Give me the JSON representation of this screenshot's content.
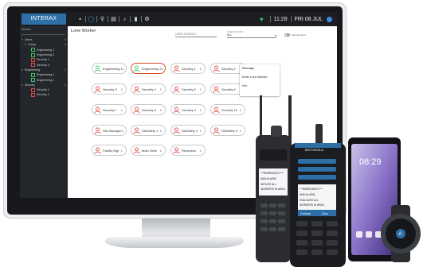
{
  "app": {
    "logo": "INTERAX"
  },
  "toolbar": {
    "icons": [
      "layout-icon",
      "user-icon",
      "location-icon",
      "radio-icon",
      "mic-icon",
      "stats-icon",
      "settings-icon"
    ]
  },
  "status": {
    "time": "11:28",
    "date": "FRI 08 JUL"
  },
  "sidebar": {
    "search_label": "Search",
    "tree": [
      {
        "arrow": "▾",
        "label": "Users",
        "count": "4",
        "indent": 0,
        "kind": "group"
      },
      {
        "arrow": "▾",
        "label": "Group",
        "count": "4",
        "indent": 1,
        "kind": "group"
      },
      {
        "arrow": "",
        "label": "Engineering 1",
        "count": "",
        "indent": 2,
        "kind": "green"
      },
      {
        "arrow": "",
        "label": "Engineering 2",
        "count": "",
        "indent": 2,
        "kind": "green"
      },
      {
        "arrow": "",
        "label": "Security 1",
        "count": "",
        "indent": 2,
        "kind": "red"
      },
      {
        "arrow": "",
        "label": "Security 4",
        "count": "",
        "indent": 2,
        "kind": "red"
      },
      {
        "arrow": "▾",
        "label": "Engineering",
        "count": "2",
        "indent": 0,
        "kind": "group"
      },
      {
        "arrow": "",
        "label": "Engineering 1",
        "count": "",
        "indent": 2,
        "kind": "green"
      },
      {
        "arrow": "",
        "label": "Engineering 2",
        "count": "",
        "indent": 2,
        "kind": "green"
      },
      {
        "arrow": "▾",
        "label": "Security",
        "count": "2",
        "indent": 0,
        "kind": "group"
      },
      {
        "arrow": "",
        "label": "Security 1",
        "count": "",
        "indent": 2,
        "kind": "red"
      },
      {
        "arrow": "",
        "label": "Security 4",
        "count": "",
        "indent": 2,
        "kind": "red"
      }
    ]
  },
  "main": {
    "title": "Lone Worker",
    "user_search_label": "USER SEARCH",
    "group_label": "USER GROUP",
    "group_value": "ALL",
    "toggle_label": "Map Enabled",
    "workers": [
      {
        "name": "Engineering 1",
        "count": "1",
        "status": "ok"
      },
      {
        "name": "Engineering 2",
        "count": "1",
        "status": "ok",
        "selected": true
      },
      {
        "name": "Security 1",
        "count": "1",
        "status": "alarm"
      },
      {
        "name": "Security 2",
        "count": "1",
        "status": "alarm"
      },
      {
        "name": "Security 3",
        "count": "1",
        "status": "alarm"
      },
      {
        "name": "Security 4",
        "count": "1",
        "status": "alarm"
      },
      {
        "name": "Security 5",
        "count": "1",
        "status": "alarm"
      },
      {
        "name": "Security 6",
        "count": "1",
        "status": "alarm"
      },
      {
        "name": "Security 7",
        "count": "1",
        "status": "alarm"
      },
      {
        "name": "Security 8",
        "count": "1",
        "status": "alarm"
      },
      {
        "name": "Security 9",
        "count": "1",
        "status": "alarm"
      },
      {
        "name": "Security 10",
        "count": "1",
        "status": "alarm"
      },
      {
        "name": "Site Manager",
        "count": "1",
        "status": "alarm"
      },
      {
        "name": "H&Safety 1",
        "count": "1",
        "status": "alarm"
      },
      {
        "name": "H&Safety 2",
        "count": "1",
        "status": "alarm"
      },
      {
        "name": "H&Safety 3",
        "count": "1",
        "status": "alarm"
      },
      {
        "name": "Facility Mgr",
        "count": "1",
        "status": "alarm"
      },
      {
        "name": "Main Desk",
        "count": "1",
        "status": "alarm"
      },
      {
        "name": "Reception",
        "count": "1",
        "status": "alarm"
      }
    ],
    "context_menu": [
      "Message",
      "Enter Lone Worker",
      "Info"
    ]
  },
  "devices": {
    "radio_left": {
      "screen_lines": [
        "***EMERGENCY***",
        "MAN ALARM",
        "INITIATE ALL",
        "WORKERS IN AREA"
      ]
    },
    "radio_center": {
      "brand": "MOTOROLA",
      "screen_lines": [
        "***EMERGENCY***",
        "MAN ALARM",
        "EVACUATE ALL",
        "WORKERS IN AREA"
      ],
      "softkeys": [
        "Contacts",
        "Zone"
      ]
    },
    "phone": {
      "time": "08:29"
    },
    "watch": {
      "label": "A"
    }
  },
  "colors": {
    "ok": "#3cc46b",
    "alarm": "#e04848",
    "selected_border": "#d8502e",
    "brand": "#2f6fa8"
  }
}
